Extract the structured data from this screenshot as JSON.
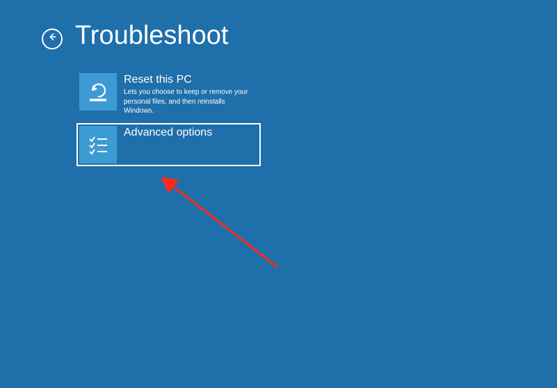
{
  "header": {
    "title": "Troubleshoot"
  },
  "options": {
    "reset": {
      "title": "Reset this PC",
      "description": "Lets you choose to keep or remove your personal files, and then reinstalls Windows."
    },
    "advanced": {
      "title": "Advanced options"
    }
  },
  "colors": {
    "background": "#1f6fab",
    "tile_icon_bg": "#3d9bd4",
    "text": "#ffffff",
    "arrow": "#ff2a1a"
  }
}
